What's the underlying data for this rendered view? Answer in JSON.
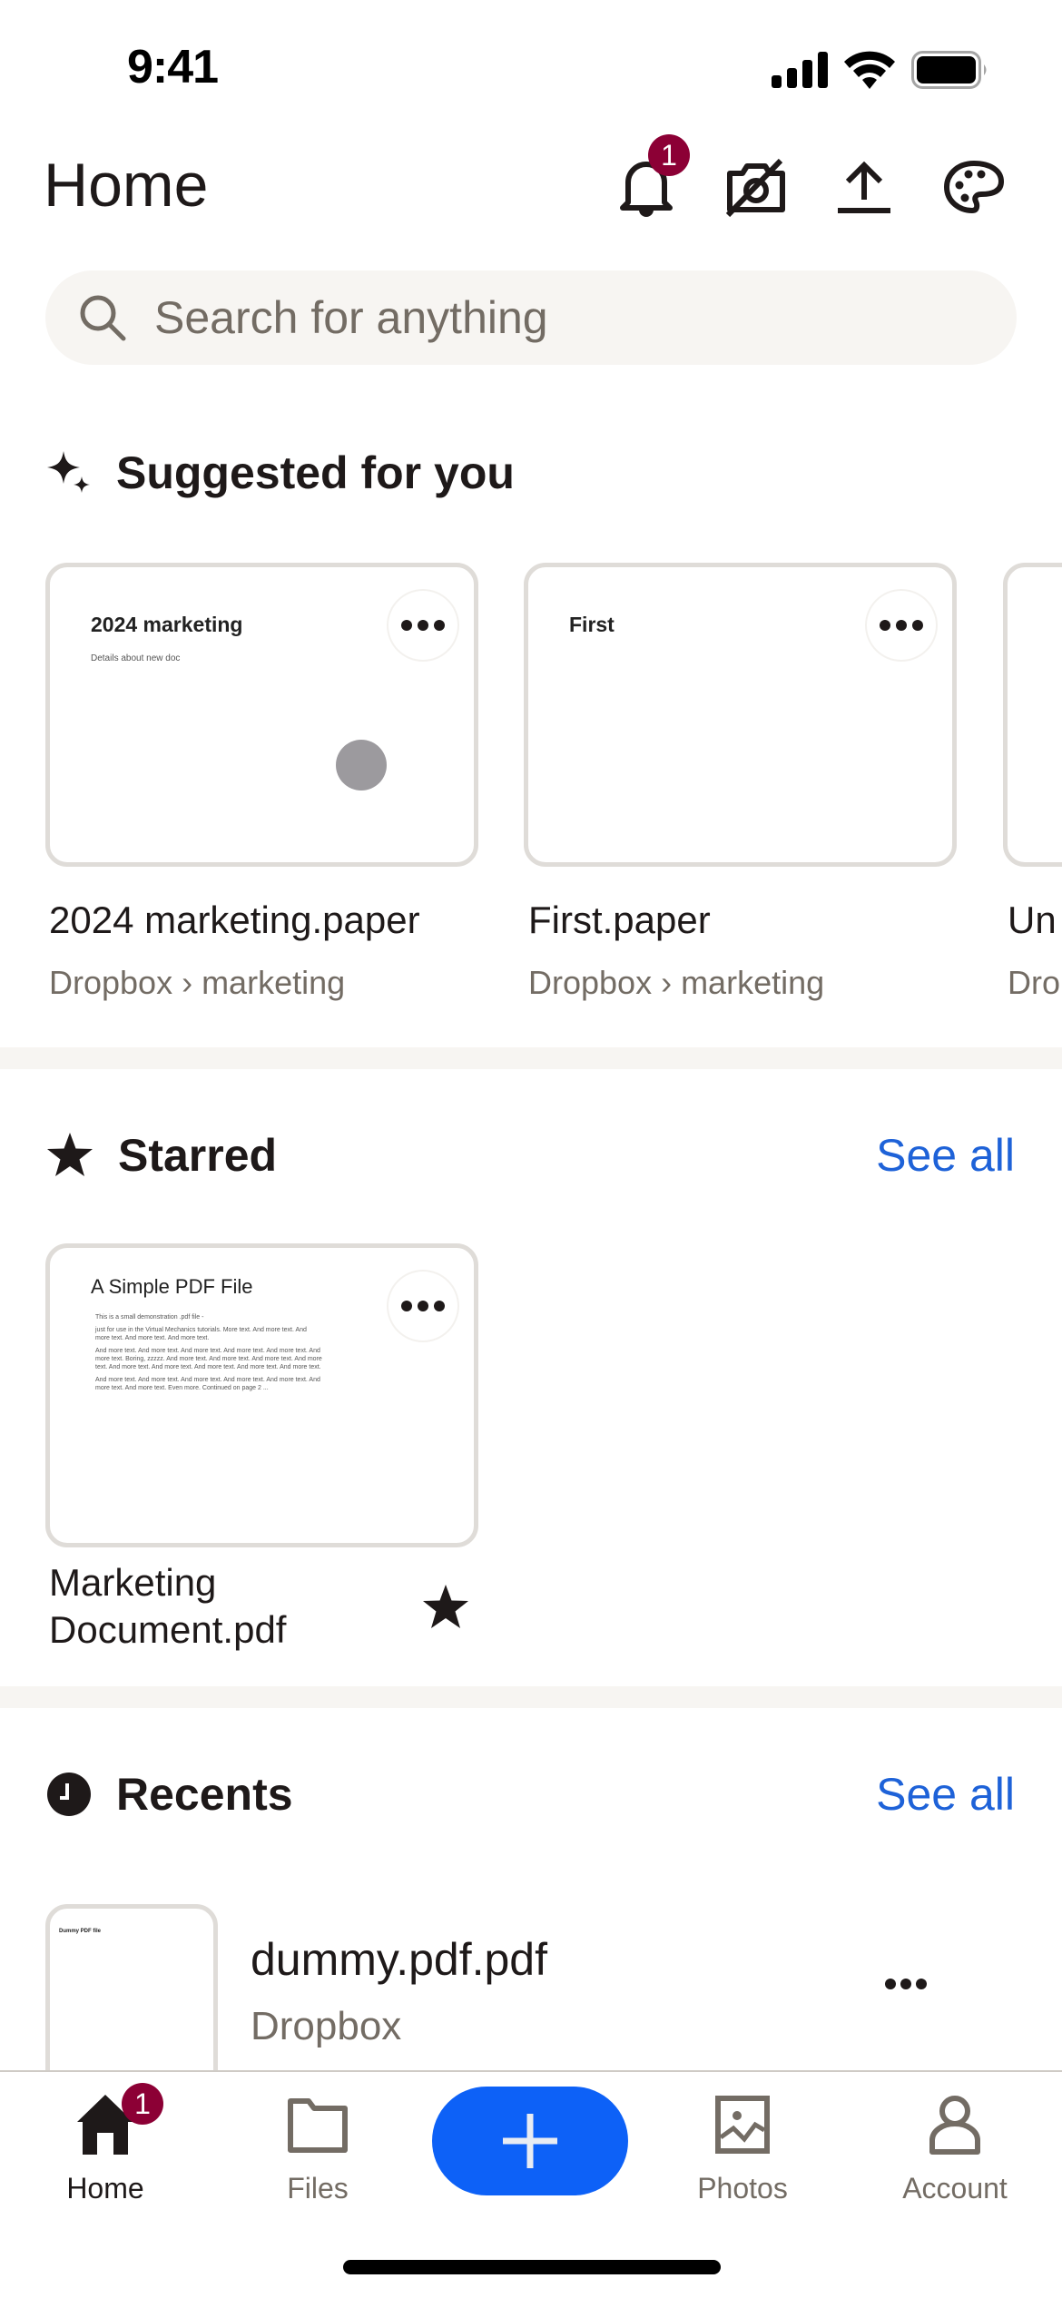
{
  "status_bar": {
    "time": "9:41",
    "icons": [
      "signal-icon",
      "wifi-icon",
      "battery-icon"
    ]
  },
  "header": {
    "title": "Home",
    "notification_badge": "1",
    "icons": [
      "bell-icon",
      "camera-off-icon",
      "upload-icon",
      "palette-icon"
    ]
  },
  "search": {
    "placeholder": "Search for anything",
    "value": ""
  },
  "suggested": {
    "title": "Suggested for you",
    "items": [
      {
        "name": "2024 marketing.paper",
        "path": "Dropbox › marketing",
        "preview_title": "2024 marketing",
        "preview_sub": "Details about new doc"
      },
      {
        "name": "First.paper",
        "path": "Dropbox › marketing",
        "preview_title": "First",
        "preview_sub": ""
      },
      {
        "name": "Un",
        "path": "Dro",
        "preview_title": "",
        "preview_sub": ""
      }
    ]
  },
  "starred": {
    "title": "Starred",
    "see_all": "See all",
    "items": [
      {
        "name_line1": "Marketing",
        "name_line2": "Document.pdf",
        "preview_title": "A Simple PDF File",
        "preview_paragraphs": [
          "This is a small demonstration .pdf file -",
          "just for use in the Virtual Mechanics tutorials. More text. And more text. And more text. And more text. And more text.",
          "And more text. And more text. And more text. And more text. And more text. And more text. Boring, zzzzz. And more text. And more text. And more text. And more text. And more text. And more text. And more text. And more text. And more text.",
          "And more text. And more text. And more text. And more text. And more text. And more text. And more text. Even more. Continued on page 2 ..."
        ]
      }
    ]
  },
  "recents": {
    "title": "Recents",
    "see_all": "See all",
    "items": [
      {
        "name": "dummy.pdf.pdf",
        "path": "Dropbox",
        "preview_title": "Dummy PDF file"
      }
    ]
  },
  "bottom_nav": {
    "items": [
      {
        "label": "Home",
        "icon": "home-icon",
        "active": true,
        "badge": "1"
      },
      {
        "label": "Files",
        "icon": "folder-icon",
        "active": false
      },
      {
        "label": "",
        "icon": "plus-icon",
        "active": false
      },
      {
        "label": "Photos",
        "icon": "photo-icon",
        "active": false
      },
      {
        "label": "Account",
        "icon": "person-icon",
        "active": false
      }
    ]
  },
  "colors": {
    "accent_blue": "#0D61F7",
    "link_blue": "#1E62D8",
    "badge": "#8C0035",
    "text_primary": "#1E1919",
    "text_secondary": "#736C64",
    "surface": "#F7F5F2"
  }
}
